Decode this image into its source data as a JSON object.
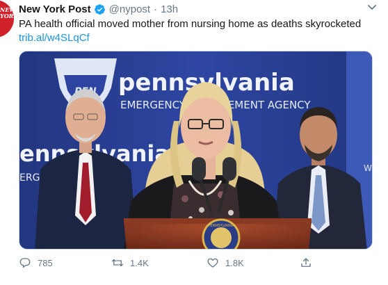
{
  "tweet": {
    "avatar_text": "NEW YORK",
    "display_name": "New York Post",
    "handle": "@nypost",
    "separator": "·",
    "timestamp": "13h",
    "text": "PA health official moved mother from nursing home as deaths skyrocketed",
    "link": "trib.al/w4SLqCf",
    "stats": {
      "replies": "785",
      "retweets": "1.4K",
      "likes": "1.8K"
    }
  },
  "photo": {
    "backdrop_word": "pennsylvania",
    "backdrop_subtitle": "EMERGENCY MANAGEMENT AGENCY",
    "left_partial_word": "ennsylvania",
    "left_partial_sub": "ERG",
    "keystone_text": "PEN",
    "seal_text": "PENNSYLVANIA",
    "right_edge_letter": "W"
  },
  "colors": {
    "brand_red": "#d0202a",
    "verified_blue": "#1da1f2",
    "link_blue": "#1b95e0",
    "muted_gray": "#657786"
  }
}
